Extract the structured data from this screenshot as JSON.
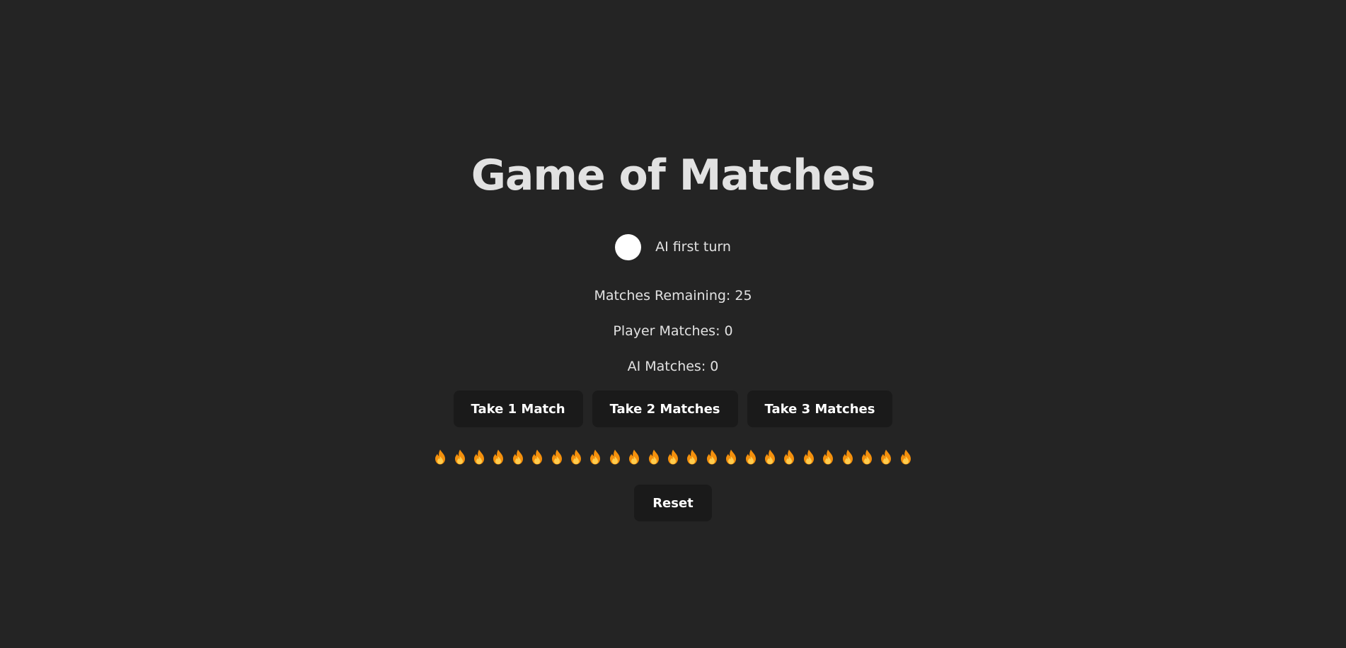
{
  "header": {
    "title": "Game of Matches"
  },
  "toggle": {
    "label": "AI first turn",
    "checked": false
  },
  "stats": {
    "remaining": "Matches Remaining: 25",
    "player": "Player Matches: 0",
    "ai": "AI Matches: 0"
  },
  "actions": {
    "take1": "Take 1 Match",
    "take2": "Take 2 Matches",
    "take3": "Take 3 Matches",
    "reset": "Reset"
  },
  "matches": {
    "count": 25,
    "icon": "fire-icon",
    "color_outer": "#f4900c",
    "color_inner": "#ffcc4d",
    "color_core": "#e25822"
  },
  "colors": {
    "background": "#242424",
    "button_bg": "#1a1a1a",
    "text": "#e6e6e6"
  }
}
